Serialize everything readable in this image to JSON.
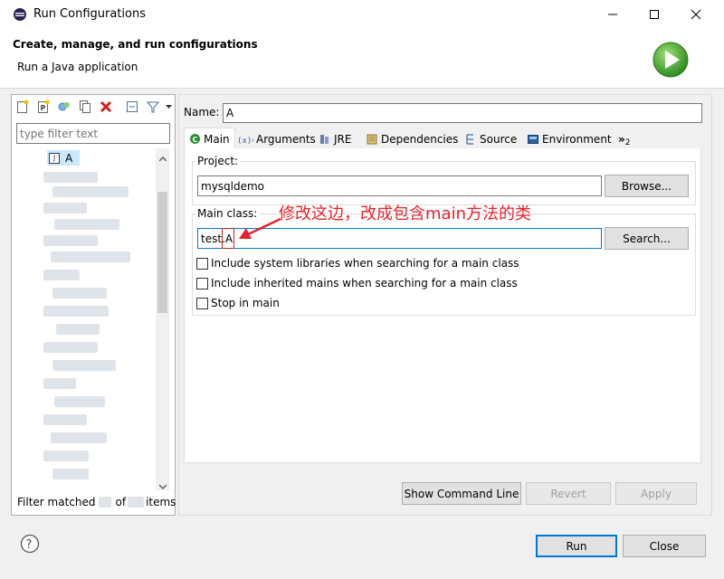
{
  "window": {
    "title": "Run Configurations",
    "minimize_icon": "minimize-icon",
    "maximize_icon": "maximize-icon",
    "close_icon": "close-icon"
  },
  "banner": {
    "heading": "Create, manage, and run configurations",
    "subheading": "Run a Java application",
    "run_icon": "run-launch-icon"
  },
  "left_panel": {
    "toolbar_icons": [
      "new-configuration-icon",
      "new-prototype-icon",
      "export-icon",
      "duplicate-icon",
      "delete-icon",
      "collapse-all-icon",
      "filter-icon",
      "view-menu-icon"
    ],
    "filter_placeholder": "type filter text",
    "tree_selected_item": "A",
    "status": {
      "prefix": "Filter matched",
      "middle": "of",
      "suffix": "items"
    }
  },
  "right_panel": {
    "name_label": "Name:",
    "name_value": "A",
    "tabs": [
      {
        "label": "Main",
        "icon": "main-tab-icon",
        "active": true
      },
      {
        "label": "Arguments",
        "icon": "arguments-icon"
      },
      {
        "label": "JRE",
        "icon": "jre-icon"
      },
      {
        "label": "Dependencies",
        "icon": "dependencies-icon"
      },
      {
        "label": "Source",
        "icon": "source-icon"
      },
      {
        "label": "Environment",
        "icon": "environment-icon"
      }
    ],
    "tabs_overflow": "»",
    "tabs_overflow_count": "2",
    "project_label": "Project:",
    "project_value": "mysqldemo",
    "browse_button": "Browse...",
    "main_class_label": "Main class:",
    "main_class_value": "test.A",
    "search_button": "Search...",
    "annotation": "修改这边，改成包含main方法的类",
    "annotation_color": "#e8232b",
    "checkboxes": [
      "Include system libraries when searching for a main class",
      "Include inherited mains when searching for a main class",
      "Stop in main"
    ],
    "show_command_line_button": "Show Command Line",
    "revert_button": "Revert",
    "apply_button": "Apply"
  },
  "footer": {
    "help_icon": "help-icon",
    "run_button": "Run",
    "close_button": "Close"
  },
  "colors": {
    "accent": "#0078d7",
    "selection": "#cce8ff"
  }
}
